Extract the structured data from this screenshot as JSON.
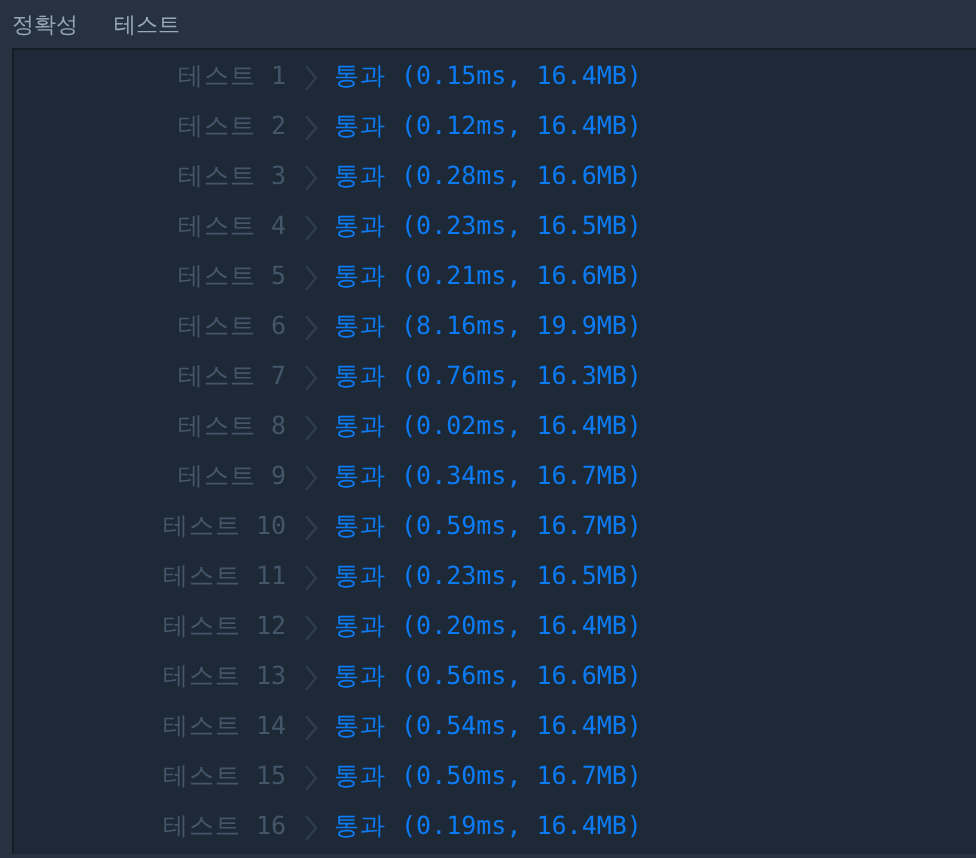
{
  "header": [
    "정확성",
    "테스트"
  ],
  "rows": [
    {
      "label": "테스트 1",
      "result": "통과 (0.15ms, 16.4MB)"
    },
    {
      "label": "테스트 2",
      "result": "통과 (0.12ms, 16.4MB)"
    },
    {
      "label": "테스트 3",
      "result": "통과 (0.28ms, 16.6MB)"
    },
    {
      "label": "테스트 4",
      "result": "통과 (0.23ms, 16.5MB)"
    },
    {
      "label": "테스트 5",
      "result": "통과 (0.21ms, 16.6MB)"
    },
    {
      "label": "테스트 6",
      "result": "통과 (8.16ms, 19.9MB)"
    },
    {
      "label": "테스트 7",
      "result": "통과 (0.76ms, 16.3MB)"
    },
    {
      "label": "테스트 8",
      "result": "통과 (0.02ms, 16.4MB)"
    },
    {
      "label": "테스트 9",
      "result": "통과 (0.34ms, 16.7MB)"
    },
    {
      "label": "테스트 10",
      "result": "통과 (0.59ms, 16.7MB)"
    },
    {
      "label": "테스트 11",
      "result": "통과 (0.23ms, 16.5MB)"
    },
    {
      "label": "테스트 12",
      "result": "통과 (0.20ms, 16.4MB)"
    },
    {
      "label": "테스트 13",
      "result": "통과 (0.56ms, 16.6MB)"
    },
    {
      "label": "테스트 14",
      "result": "통과 (0.54ms, 16.4MB)"
    },
    {
      "label": "테스트 15",
      "result": "통과 (0.50ms, 16.7MB)"
    },
    {
      "label": "테스트 16",
      "result": "통과 (0.19ms, 16.4MB)"
    }
  ]
}
